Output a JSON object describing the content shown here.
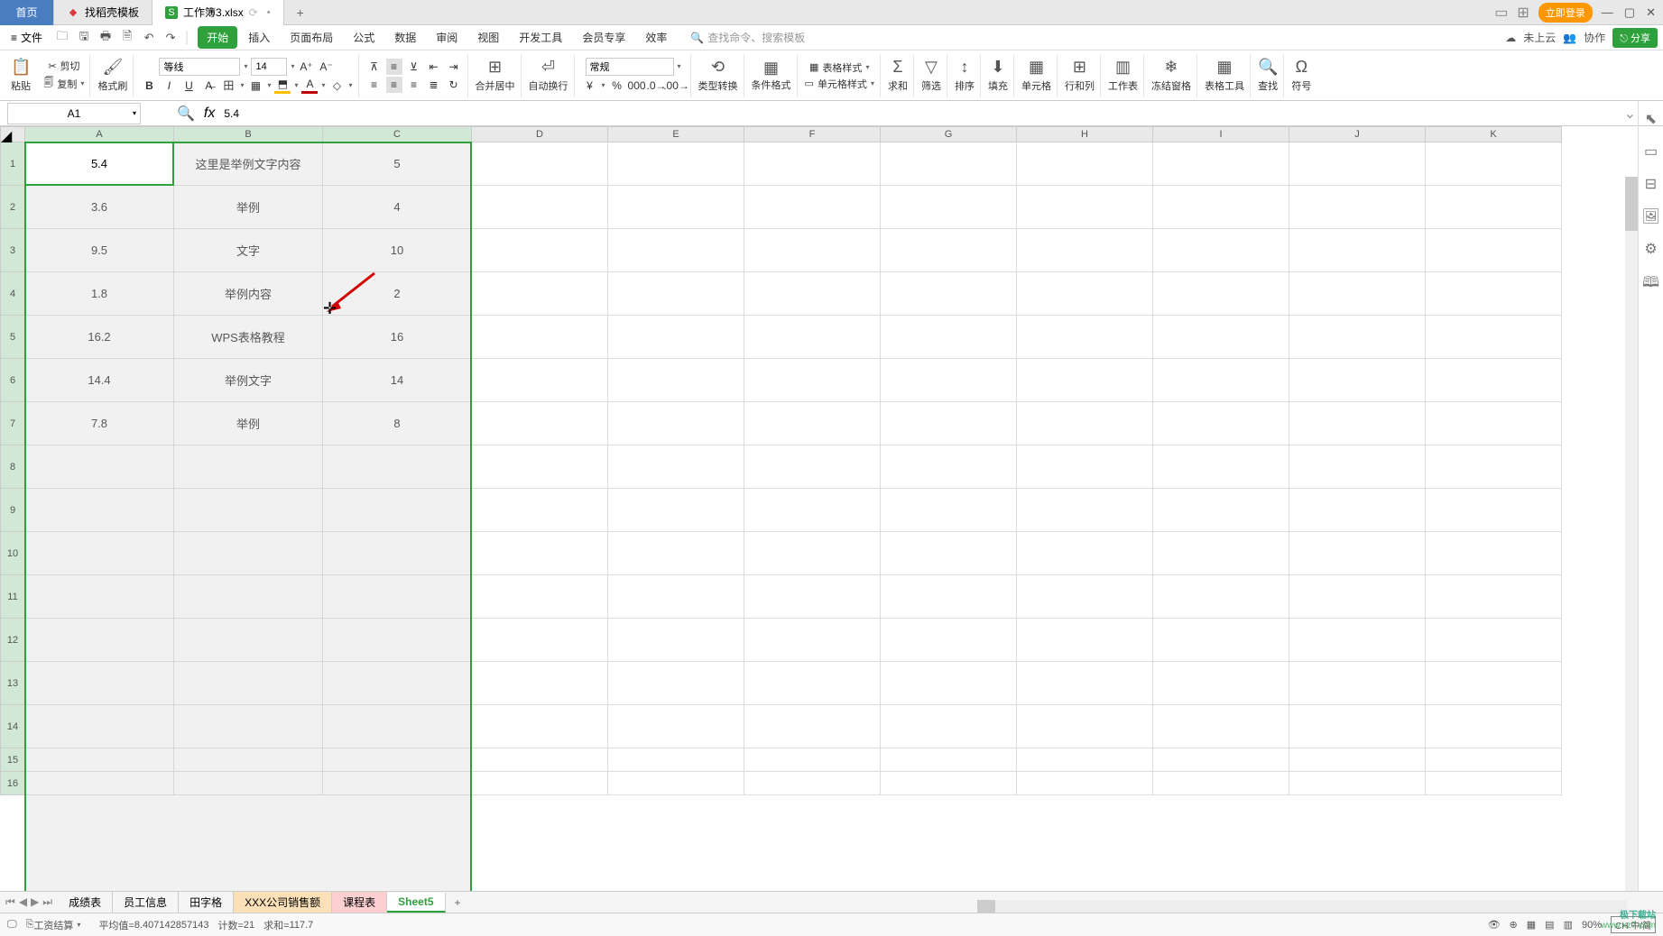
{
  "tabs": {
    "home": "首页",
    "template": "找稻壳模板",
    "workbook": "工作簿3.xlsx"
  },
  "topRight": {
    "login": "立即登录"
  },
  "menu": {
    "file": "文件",
    "tabs": [
      "开始",
      "插入",
      "页面布局",
      "公式",
      "数据",
      "审阅",
      "视图",
      "开发工具",
      "会员专享",
      "效率"
    ],
    "searchPlaceholder": "查找命令、搜索模板",
    "cloud": "未上云",
    "coop": "协作",
    "share": "分享"
  },
  "ribbon": {
    "paste": "粘贴",
    "cut": "剪切",
    "copy": "复制",
    "formatPainter": "格式刷",
    "fontName": "等线",
    "fontSize": "14",
    "merge": "合并居中",
    "wrap": "自动换行",
    "numFormat": "常规",
    "typeConvert": "类型转换",
    "condFormat": "条件格式",
    "tableStyle": "表格样式",
    "cellStyle": "单元格样式",
    "sum": "求和",
    "filter": "筛选",
    "sort": "排序",
    "fill": "填充",
    "cells": "单元格",
    "rowsCols": "行和列",
    "worksheet": "工作表",
    "freeze": "冻结窗格",
    "tableTools": "表格工具",
    "find": "查找",
    "symbol": "符号"
  },
  "nameBox": "A1",
  "formulaValue": "5.4",
  "columns": [
    "A",
    "B",
    "C",
    "D",
    "E",
    "F",
    "G",
    "H",
    "I",
    "J",
    "K"
  ],
  "rows": [
    1,
    2,
    3,
    4,
    5,
    6,
    7,
    8,
    9,
    10,
    11,
    12,
    13,
    14,
    15,
    16
  ],
  "cells": {
    "A": [
      "5.4",
      "3.6",
      "9.5",
      "1.8",
      "16.2",
      "14.4",
      "7.8"
    ],
    "B": [
      "这里是举例文字内容",
      "举例",
      "文字",
      "举例内容",
      "WPS表格教程",
      "举例文字",
      "举例"
    ],
    "C": [
      "5",
      "4",
      "10",
      "2",
      "16",
      "14",
      "8"
    ]
  },
  "sheetTabs": {
    "items": [
      "成绩表",
      "员工信息",
      "田字格",
      "XXX公司销售额",
      "课程表",
      "Sheet5"
    ]
  },
  "status": {
    "calc": "工资结算",
    "avgLabel": "平均值=",
    "avg": "8.407142857143",
    "countLabel": "计数=",
    "count": "21",
    "sumLabel": "求和=",
    "sum": "117.7",
    "zoom": "90%",
    "ime": "CH 中/简"
  },
  "watermark": {
    "l1": "极下载站",
    "l2": "www.xz7.com"
  }
}
